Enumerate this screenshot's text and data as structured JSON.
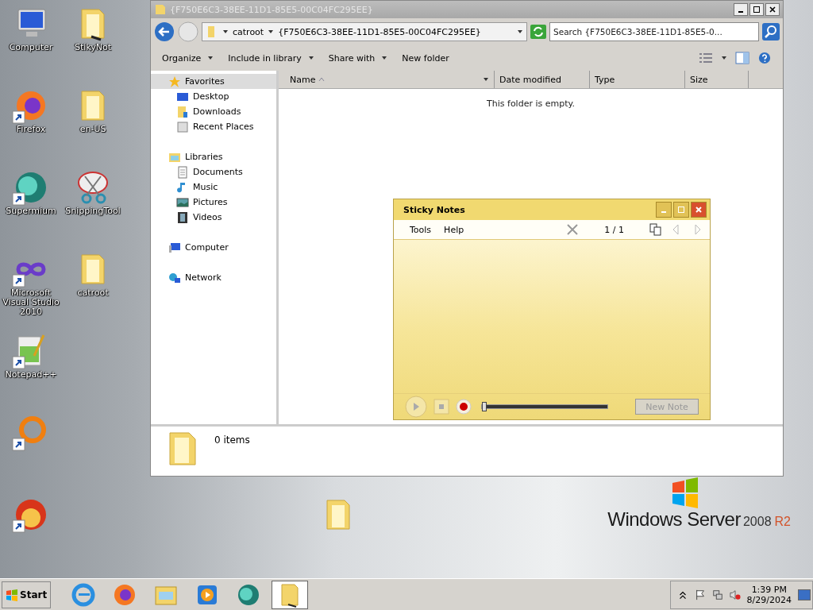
{
  "desktop_icons": [
    {
      "kind": "monitor",
      "label": "Computer",
      "shortcut": false
    },
    {
      "kind": "firefox",
      "label": "Firefox",
      "shortcut": true
    },
    {
      "kind": "supermium",
      "label": "Supermium",
      "shortcut": true
    },
    {
      "kind": "infinity",
      "label": "Microsoft Visual Studio 2010",
      "shortcut": true
    },
    {
      "kind": "notepad",
      "label": "Notepad++",
      "shortcut": true
    },
    {
      "kind": "ring",
      "shortcut": true
    },
    {
      "kind": "torrent",
      "shortcut": true
    },
    {
      "kind": "folder-pen",
      "label": "StikyNot",
      "shortcut": false
    },
    {
      "kind": "folder",
      "label": "en-US",
      "shortcut": false
    },
    {
      "kind": "scissors",
      "label": "SnippingTool",
      "shortcut": false
    },
    {
      "kind": "folder",
      "label": "catroot",
      "shortcut": false
    }
  ],
  "desktop_folder": {
    "kind": "folder"
  },
  "logo": {
    "name": "Windows Server",
    "version": "2008",
    "edition": "R2"
  },
  "explorer": {
    "title": "{F750E6C3-38EE-11D1-85E5-00C04FC295EE}",
    "breadcrumbs": [
      "catroot",
      "{F750E6C3-38EE-11D1-85E5-00C04FC295EE}"
    ],
    "search": {
      "placeholder": "Search {F750E6C3-38EE-11D1-85E5-0..."
    },
    "toolbar": [
      {
        "label": "Organize",
        "dropdown": true
      },
      {
        "label": "Include in library",
        "dropdown": true
      },
      {
        "label": "Share with",
        "dropdown": true
      },
      {
        "label": "New folder",
        "dropdown": false
      }
    ],
    "nav": [
      {
        "kind": "star",
        "label": "Favorites",
        "selected": true,
        "children": [
          {
            "kind": "desktop",
            "label": "Desktop",
            "selected": false
          },
          {
            "kind": "downloads",
            "label": "Downloads",
            "selected": false
          },
          {
            "kind": "recent",
            "label": "Recent Places",
            "selected": false
          }
        ]
      },
      {
        "kind": "library",
        "label": "Libraries",
        "selected": false,
        "children": [
          {
            "kind": "document",
            "label": "Documents",
            "selected": false
          },
          {
            "kind": "music",
            "label": "Music",
            "selected": false
          },
          {
            "kind": "pictures",
            "label": "Pictures",
            "selected": false
          },
          {
            "kind": "videos",
            "label": "Videos",
            "selected": false
          }
        ]
      },
      {
        "kind": "computer",
        "label": "Computer",
        "selected": false
      },
      {
        "kind": "network",
        "label": "Network",
        "selected": false
      }
    ],
    "columns": [
      {
        "label": "Name",
        "sorted": true
      },
      {
        "label": "Date modified",
        "sorted": false
      },
      {
        "label": "Type",
        "sorted": false
      },
      {
        "label": "Size",
        "sorted": false
      }
    ],
    "empty_message": "This folder is empty.",
    "status": "0 items"
  },
  "sticky": {
    "title": "Sticky Notes",
    "menu": [
      "Tools",
      "Help"
    ],
    "page": "1 / 1",
    "level": 0,
    "new_note": {
      "label": "New Note",
      "disabled": true
    }
  },
  "taskbar": {
    "start": "Start",
    "items": [
      {
        "kind": "ie",
        "selected": false
      },
      {
        "kind": "firefox",
        "selected": false
      },
      {
        "kind": "explorer",
        "selected": false
      },
      {
        "kind": "media",
        "selected": false
      },
      {
        "kind": "supermium",
        "selected": false
      },
      {
        "kind": "folder-pen",
        "selected": true
      }
    ],
    "time": "1:39 PM",
    "date": "8/29/2024"
  }
}
